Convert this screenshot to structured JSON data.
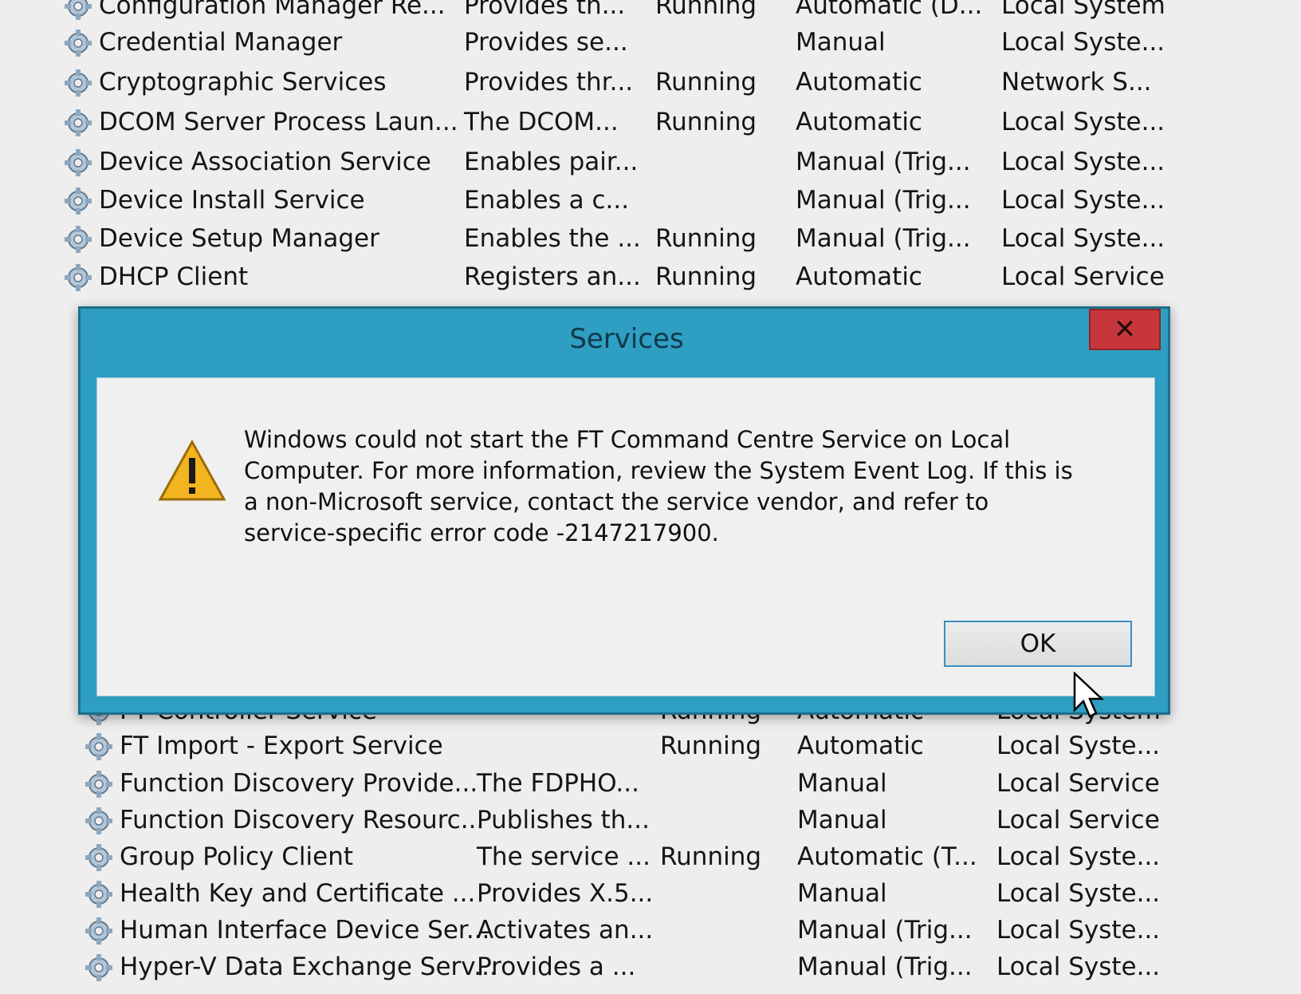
{
  "services_upper": [
    {
      "name": "Configuration Manager Re...",
      "description": "Provides th...",
      "status": "Running",
      "startup": "Automatic (D...",
      "logon": "Local System"
    },
    {
      "name": "Credential Manager",
      "description": "Provides se...",
      "status": "",
      "startup": "Manual",
      "logon": "Local Syste..."
    },
    {
      "name": "Cryptographic Services",
      "description": "Provides thr...",
      "status": "Running",
      "startup": "Automatic",
      "logon": "Network S..."
    },
    {
      "name": "DCOM Server Process Laun...",
      "description": "The DCOM...",
      "status": "Running",
      "startup": "Automatic",
      "logon": "Local Syste..."
    },
    {
      "name": "Device Association Service",
      "description": "Enables pair...",
      "status": "",
      "startup": "Manual (Trig...",
      "logon": "Local Syste..."
    },
    {
      "name": "Device Install Service",
      "description": "Enables a c...",
      "status": "",
      "startup": "Manual (Trig...",
      "logon": "Local Syste..."
    },
    {
      "name": "Device Setup Manager",
      "description": "Enables the ...",
      "status": "Running",
      "startup": "Manual (Trig...",
      "logon": "Local Syste..."
    },
    {
      "name": "DHCP Client",
      "description": "Registers an...",
      "status": "Running",
      "startup": "Automatic",
      "logon": "Local Service"
    }
  ],
  "services_lower": [
    {
      "name": "FT Controller Service",
      "description": "",
      "status": "Running",
      "startup": "Automatic",
      "logon": "Local System"
    },
    {
      "name": "FT Import - Export Service",
      "description": "",
      "status": "Running",
      "startup": "Automatic",
      "logon": "Local Syste..."
    },
    {
      "name": "Function Discovery Provide...",
      "description": "The FDPHO...",
      "status": "",
      "startup": "Manual",
      "logon": "Local Service"
    },
    {
      "name": "Function Discovery Resourc...",
      "description": "Publishes th...",
      "status": "",
      "startup": "Manual",
      "logon": "Local Service"
    },
    {
      "name": "Group Policy Client",
      "description": "The service ...",
      "status": "Running",
      "startup": "Automatic (T...",
      "logon": "Local Syste..."
    },
    {
      "name": "Health Key and Certificate ...",
      "description": "Provides X.5...",
      "status": "",
      "startup": "Manual",
      "logon": "Local Syste..."
    },
    {
      "name": "Human Interface Device Ser...",
      "description": "Activates an...",
      "status": "",
      "startup": "Manual (Trig...",
      "logon": "Local Syste..."
    },
    {
      "name": "Hyper-V Data Exchange Serv...",
      "description": "Provides a ...",
      "status": "",
      "startup": "Manual (Trig...",
      "logon": "Local Syste..."
    }
  ],
  "dialog": {
    "title": "Services",
    "close_label": "✕",
    "message": "Windows could not start the FT Command Centre Service on Local Computer. For more information, review the System Event Log. If this is a non-Microsoft service, contact the service vendor, and refer to service-specific error code -2147217900.",
    "ok_label": "OK",
    "icon": "warning-icon"
  },
  "icons": {
    "service": "gear-icon",
    "pointer": "mouse-pointer-icon"
  },
  "colors": {
    "dialog_frame": "#2e9ec2",
    "close_button": "#c6363a",
    "warning_fill": "#f2b51f"
  }
}
